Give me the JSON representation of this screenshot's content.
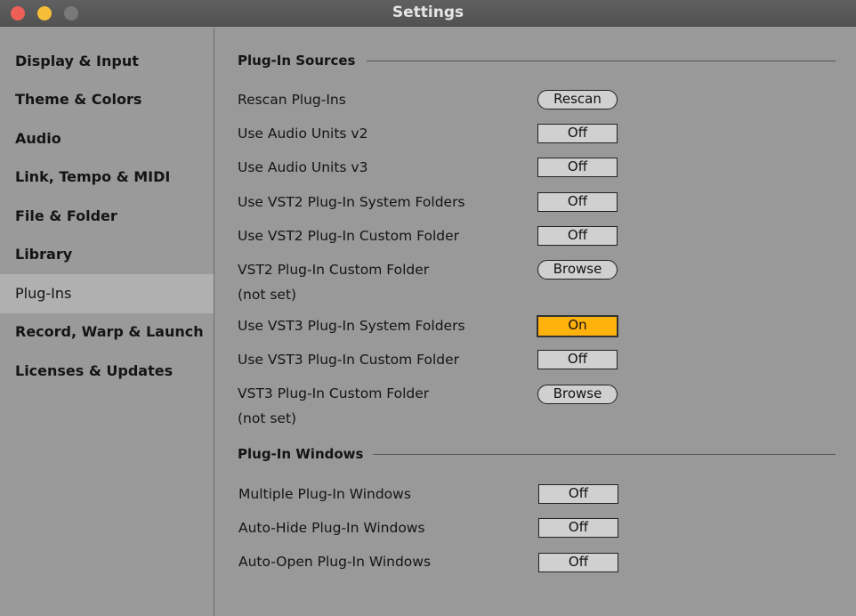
{
  "window": {
    "title": "Settings"
  },
  "sidebar": {
    "items": [
      {
        "label": "Display & Input"
      },
      {
        "label": "Theme & Colors"
      },
      {
        "label": "Audio"
      },
      {
        "label": "Link, Tempo & MIDI"
      },
      {
        "label": "File & Folder"
      },
      {
        "label": "Library"
      },
      {
        "label": "Plug-Ins",
        "selected": true
      },
      {
        "label": "Record, Warp & Launch"
      },
      {
        "label": "Licenses & Updates"
      }
    ]
  },
  "sections": {
    "sources": {
      "title": "Plug-In Sources"
    },
    "windows": {
      "title": "Plug-In Windows"
    }
  },
  "rows": {
    "rescan": {
      "label": "Rescan Plug-Ins",
      "button": "Rescan"
    },
    "au2": {
      "label": "Use Audio Units v2",
      "value": "Off"
    },
    "au3": {
      "label": "Use Audio Units v3",
      "value": "Off"
    },
    "vst2sys": {
      "label": "Use VST2 Plug-In System Folders",
      "value": "Off"
    },
    "vst2custom": {
      "label": "Use VST2 Plug-In Custom Folder",
      "value": "Off"
    },
    "vst2folder": {
      "label": "VST2 Plug-In Custom Folder",
      "sublabel": "(not set)",
      "button": "Browse"
    },
    "vst3sys": {
      "label": "Use VST3 Plug-In System Folders",
      "value": "On"
    },
    "vst3custom": {
      "label": "Use VST3 Plug-In Custom Folder",
      "value": "Off"
    },
    "vst3folder": {
      "label": "VST3 Plug-In Custom Folder",
      "sublabel": "(not set)",
      "button": "Browse"
    },
    "multi": {
      "label": "Multiple Plug-In Windows",
      "value": "Off"
    },
    "autohide": {
      "label": "Auto-Hide Plug-In Windows",
      "value": "Off"
    },
    "autoopen": {
      "label": "Auto-Open Plug-In Windows",
      "value": "Off"
    }
  },
  "colors": {
    "accent_on": "#ffb10c"
  }
}
